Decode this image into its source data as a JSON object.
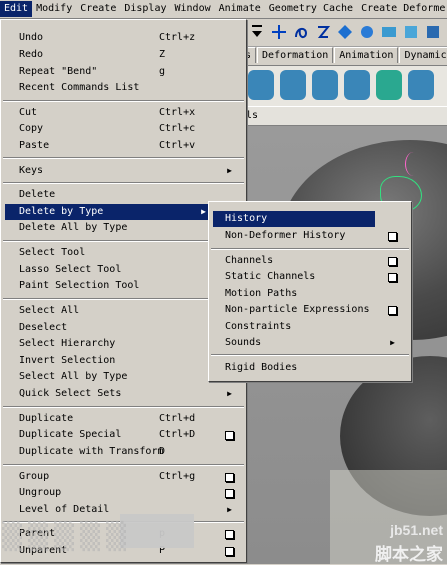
{
  "menubar": [
    "Edit",
    "Modify",
    "Create",
    "Display",
    "Window",
    "Animate",
    "Geometry Cache",
    "Create Deformers"
  ],
  "shelf_tabs": [
    "s",
    "Deformation",
    "Animation",
    "Dynamics"
  ],
  "viewport_label": "els",
  "edit_menu": [
    {
      "label": "Undo",
      "shortcut": "Ctrl+z"
    },
    {
      "label": "Redo",
      "shortcut": "Z"
    },
    {
      "label": "Repeat \"Bend\"",
      "shortcut": "g"
    },
    {
      "label": "Recent Commands List",
      "shortcut": ""
    },
    {
      "label": "Cut",
      "shortcut": "Ctrl+x"
    },
    {
      "label": "Copy",
      "shortcut": "Ctrl+c"
    },
    {
      "label": "Paste",
      "shortcut": "Ctrl+v"
    },
    {
      "label": "Keys",
      "shortcut": "",
      "submenu": true
    },
    {
      "label": "Delete",
      "shortcut": ""
    },
    {
      "label": "Delete by Type",
      "shortcut": "",
      "submenu": true,
      "active": true
    },
    {
      "label": "Delete All by Type",
      "shortcut": "",
      "submenu": true
    },
    {
      "label": "Select Tool",
      "shortcut": ""
    },
    {
      "label": "Lasso Select Tool",
      "shortcut": ""
    },
    {
      "label": "Paint Selection Tool",
      "shortcut": ""
    },
    {
      "label": "Select All",
      "shortcut": ""
    },
    {
      "label": "Deselect",
      "shortcut": ""
    },
    {
      "label": "Select Hierarchy",
      "shortcut": ""
    },
    {
      "label": "Invert Selection",
      "shortcut": ""
    },
    {
      "label": "Select All by Type",
      "shortcut": "",
      "submenu": true
    },
    {
      "label": "Quick Select Sets",
      "shortcut": "",
      "submenu": true
    },
    {
      "label": "Duplicate",
      "shortcut": "Ctrl+d"
    },
    {
      "label": "Duplicate Special",
      "shortcut": "Ctrl+D",
      "option": true
    },
    {
      "label": "Duplicate with Transform",
      "shortcut": "D"
    },
    {
      "label": "Group",
      "shortcut": "Ctrl+g",
      "option": true
    },
    {
      "label": "Ungroup",
      "shortcut": "",
      "option": true
    },
    {
      "label": "Level of Detail",
      "shortcut": "",
      "submenu": true
    },
    {
      "label": "Parent",
      "shortcut": "p",
      "option": true
    },
    {
      "label": "Unparent",
      "shortcut": "P",
      "option": true
    }
  ],
  "sub_menu": [
    {
      "label": "History",
      "active": true
    },
    {
      "label": "Non-Deformer History",
      "option": true
    },
    {
      "label": "Channels",
      "option": true
    },
    {
      "label": "Static Channels",
      "option": true
    },
    {
      "label": "Motion Paths"
    },
    {
      "label": "Non-particle Expressions",
      "option": true
    },
    {
      "label": "Constraints"
    },
    {
      "label": "Sounds",
      "submenu": true
    },
    {
      "label": "Rigid Bodies"
    }
  ],
  "watermark": {
    "site": "jb51.net",
    "cn": "脚本之家"
  }
}
